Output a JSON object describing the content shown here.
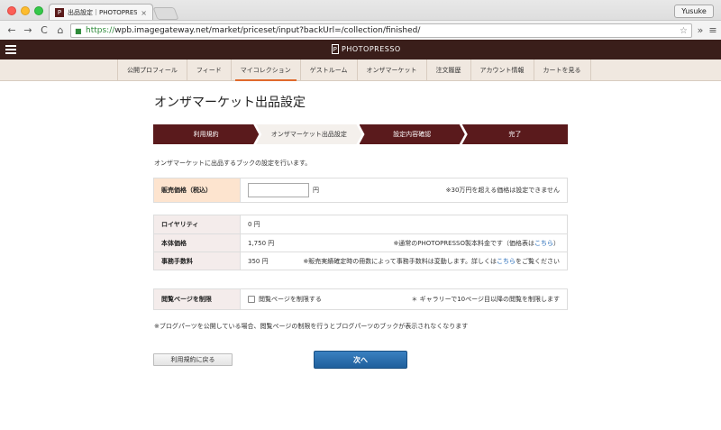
{
  "browser": {
    "tab_title": "出品設定｜PHOTOPRESSO",
    "tab_close": "×",
    "profile": "Yusuke",
    "url_scheme": "https://",
    "url_rest": "wpb.imagegateway.net/market/priceset/input?backUrl=/collection/finished/",
    "back": "←",
    "forward": "→",
    "reload": "C",
    "home": "⌂",
    "star": "☆",
    "extend": "»",
    "menu": "≡"
  },
  "site": {
    "logo": "PHOTOPRESSO"
  },
  "subnav": {
    "items": [
      {
        "label": "公開プロフィール"
      },
      {
        "label": "フィード"
      },
      {
        "label": "マイコレクション"
      },
      {
        "label": "ゲストルーム"
      },
      {
        "label": "オンザマーケット"
      },
      {
        "label": "注文履歴"
      },
      {
        "label": "アカウント情報"
      },
      {
        "label": "カートを見る"
      }
    ],
    "active_index": 2
  },
  "page": {
    "title": "オンザマーケット出品設定",
    "description": "オンザマーケットに出品するブックの設定を行います。",
    "steps": [
      "利用規約",
      "オンザマーケット出品設定",
      "設定内容確認",
      "完了"
    ],
    "current_step": 1,
    "price": {
      "label": "販売価格（税込）",
      "value": "",
      "unit": "円",
      "note": "※30万円を超える価格は設定できません"
    },
    "royalty": {
      "label": "ロイヤリティ",
      "value": "0 円"
    },
    "base_price": {
      "label": "本体価格",
      "value": "1,750 円",
      "note": "※通常のPHOTOPRESSO製本料金です（価格表は",
      "link": "こちら",
      "note_end": "）"
    },
    "fee": {
      "label": "事務手数料",
      "value": "350 円",
      "note": "※販売実績確定時の冊数によって事務手数料は変動します。詳しくは",
      "link": "こちら",
      "note_end": "をご覧ください"
    },
    "restrict": {
      "label": "閲覧ページを制限",
      "checkbox_label": "閲覧ページを制限する",
      "checked": false,
      "note": "＊ ギャラリーで10ページ目以降の閲覧を制限します"
    },
    "footnote": "※ブログパーツを公開している場合、閲覧ページの制限を行うとブログパーツのブックが表示されなくなります",
    "back_button": "利用規約に戻る",
    "next_button": "次へ"
  }
}
